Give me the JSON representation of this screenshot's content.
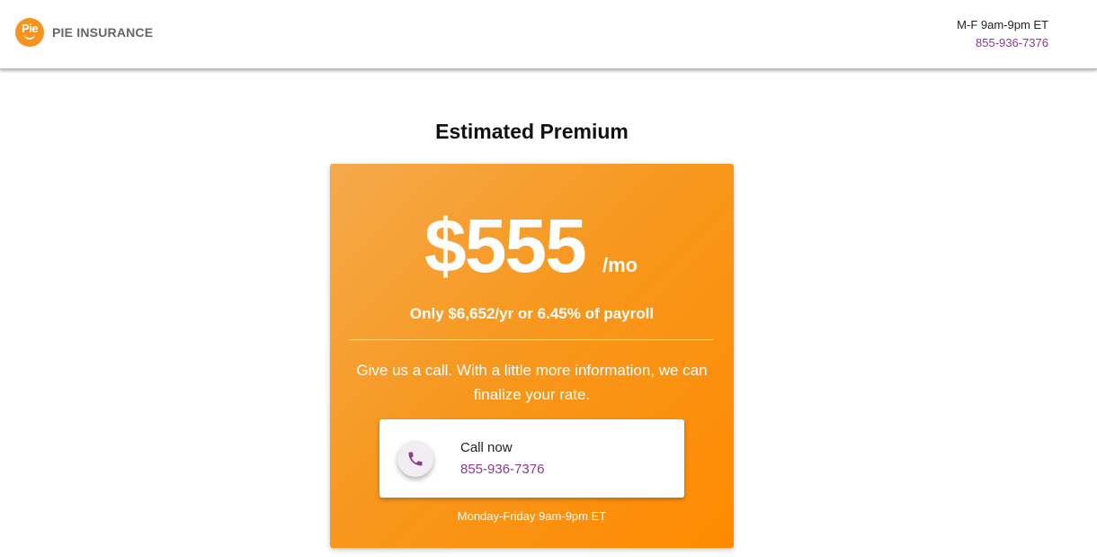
{
  "header": {
    "logo_text": "Pie",
    "brand_name": "PIE INSURANCE",
    "hours": "M-F 9am-9pm ET",
    "phone": "855-936-7376"
  },
  "main": {
    "title": "Estimated Premium",
    "card": {
      "price": "$555",
      "period": "/mo",
      "summary": "Only $6,652/yr or 6.45% of payroll",
      "message": "Give us a call. With a little more information, we can finalize your rate.",
      "call": {
        "label": "Call now",
        "phone": "855-936-7376",
        "icon": "phone-icon"
      },
      "hours": "Monday-Friday 9am-9pm ET"
    }
  },
  "colors": {
    "accent_orange": "#f7981f",
    "link_purple": "#8b3a8f"
  }
}
